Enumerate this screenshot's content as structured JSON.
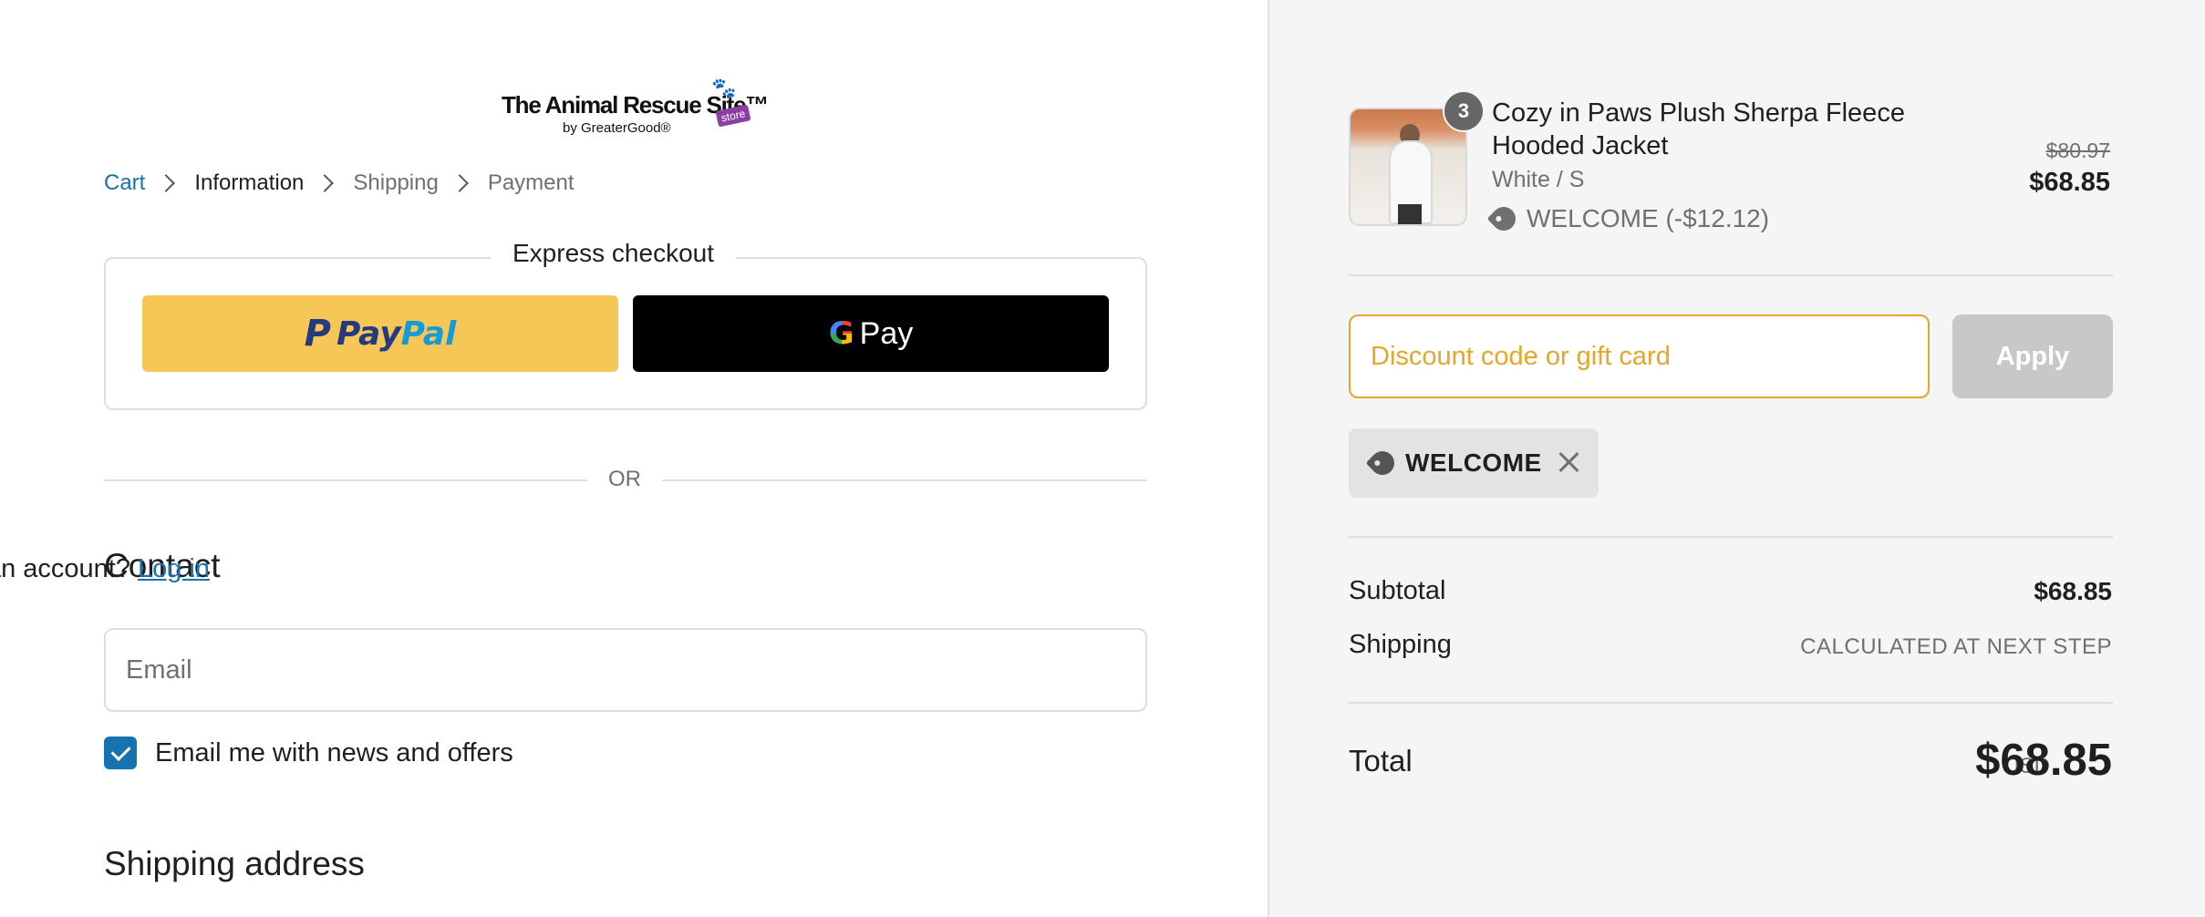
{
  "logo": {
    "line1": "The Animal Rescue Site™",
    "line2": "by GreaterGood®",
    "badge": "store",
    "colors": {
      "accent": "#8b3fa3"
    }
  },
  "breadcrumb": {
    "items": [
      "Cart",
      "Information",
      "Shipping",
      "Payment"
    ]
  },
  "express": {
    "title": "Express checkout",
    "paypal_label": "PayPal",
    "gpay_label": "Pay",
    "colors": {
      "paypal_bg": "#f6c657",
      "gpay_bg": "#000000"
    }
  },
  "divider_text": "OR",
  "contact": {
    "heading": "Contact",
    "account_prompt": "Have an account?",
    "login_label": "Log in",
    "email_placeholder": "Email",
    "email_value": "",
    "newsletter_label": "Email me with news and offers",
    "newsletter_checked": true
  },
  "shipping_address_heading": "Shipping address",
  "order": {
    "item": {
      "quantity": "3",
      "name": "Cozy in Paws Plush Sherpa Fleece Hooded Jacket",
      "variant": "White / S",
      "discount_line": "WELCOME (-$12.12)",
      "original_price": "$80.97",
      "price": "$68.85"
    },
    "discount_placeholder": "Discount code or gift card",
    "apply_label": "Apply",
    "applied_code": "WELCOME",
    "subtotal_label": "Subtotal",
    "subtotal_value": "$68.85",
    "shipping_label": "Shipping",
    "shipping_value": "CALCULATED AT NEXT STEP",
    "total_label": "Total",
    "currency": "USD",
    "total_value": "$68.85"
  },
  "colors": {
    "link": "#1773b0",
    "discount_border": "#e6a62a",
    "panel_bg": "#f5f5f5"
  }
}
